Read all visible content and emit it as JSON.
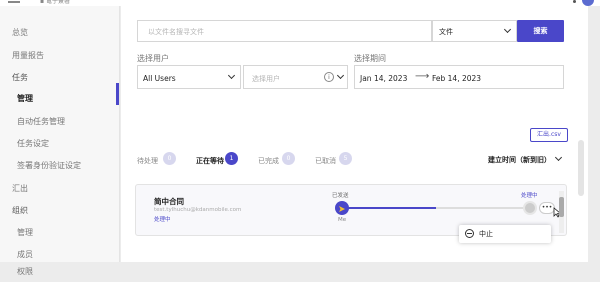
{
  "topbar": {
    "logo": "▪ 電子簽署"
  },
  "sidebar": {
    "items": [
      {
        "label": "总览"
      },
      {
        "label": "用量报告"
      },
      {
        "label": "任务"
      },
      {
        "label": "管理"
      },
      {
        "label": "自动任务管理"
      },
      {
        "label": "任务设定"
      },
      {
        "label": "签署身份验证设定"
      },
      {
        "label": "汇出"
      },
      {
        "label": "组织"
      },
      {
        "label": "管理"
      },
      {
        "label": "成员"
      }
    ],
    "bottom_item": "权限"
  },
  "filters": {
    "search_placeholder": "以文件名搜寻文件",
    "search_type_value": "文件",
    "search_button": "搜索",
    "user_label": "选择用户",
    "user_select_value": "All Users",
    "user_input_placeholder": "选择用户",
    "period_label": "选择期间",
    "date_from": "Jan 14, 2023",
    "date_arrow": "⟶",
    "date_to": "Feb 14, 2023",
    "info_glyph": "i"
  },
  "export_button": "汇出.csv",
  "tabs": [
    {
      "label": "待处理",
      "count": "0"
    },
    {
      "label": "正在等待",
      "count": "1"
    },
    {
      "label": "已完成",
      "count": "0"
    },
    {
      "label": "已取消",
      "count": "5"
    }
  ],
  "sort": {
    "label": "建立时间（新到旧）"
  },
  "task": {
    "title": "简中合同",
    "email": "test.tylhuchu@kdanmobile.com",
    "status": "处理中",
    "step1_label": "已发送",
    "step1_sub": "Me",
    "step2_label": "处理中",
    "more_glyph": "•••",
    "progress_complete": 0.5
  },
  "popover": {
    "item": "中止"
  },
  "colors": {
    "accent": "#4a47c9",
    "badge_inactive": "#d7d7ee"
  }
}
